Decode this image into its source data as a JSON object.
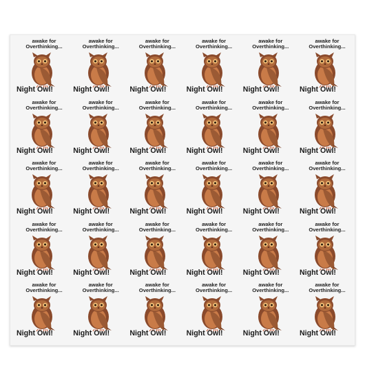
{
  "sticker": {
    "caption": "awake for\nOverthinking...",
    "title": "Night Owl!"
  },
  "layout": {
    "rows": 5,
    "cols": 6
  },
  "colors": {
    "owl_body": "#8a4a2c",
    "owl_belly": "#c97b48",
    "owl_wing": "#9b5a34",
    "owl_face": "#b06a3c",
    "owl_eye": "#f3c27a",
    "background": "#f5f5f5",
    "text": "#1a1a1a"
  }
}
